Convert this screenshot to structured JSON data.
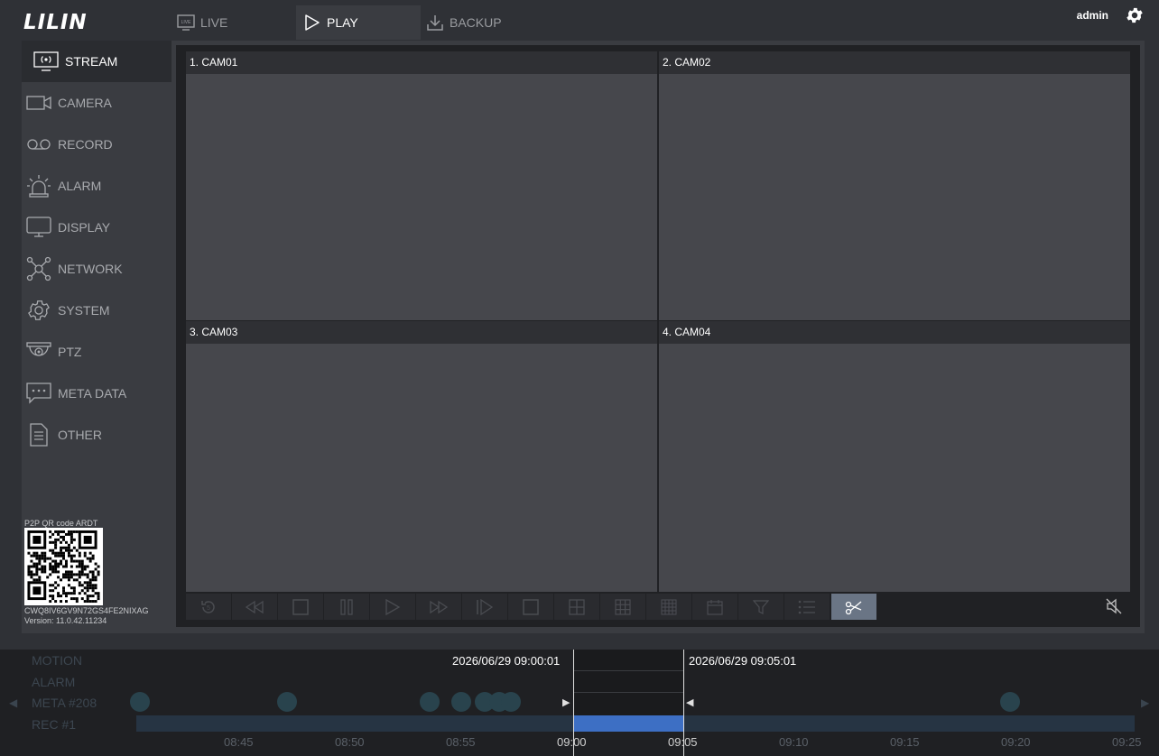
{
  "header": {
    "logo": "LILIN",
    "tabs": [
      {
        "label": "LIVE"
      },
      {
        "label": "PLAY"
      },
      {
        "label": "BACKUP"
      }
    ],
    "user": "admin"
  },
  "sidebar": {
    "items": [
      {
        "label": "STREAM",
        "icon": "stream-icon"
      },
      {
        "label": "CAMERA",
        "icon": "camera-icon"
      },
      {
        "label": "RECORD",
        "icon": "record-icon"
      },
      {
        "label": "ALARM",
        "icon": "alarm-icon"
      },
      {
        "label": "DISPLAY",
        "icon": "display-icon"
      },
      {
        "label": "NETWORK",
        "icon": "network-icon"
      },
      {
        "label": "SYSTEM",
        "icon": "system-icon"
      },
      {
        "label": "PTZ",
        "icon": "ptz-icon"
      },
      {
        "label": "META DATA",
        "icon": "metadata-icon"
      },
      {
        "label": "OTHER",
        "icon": "other-icon"
      }
    ],
    "qr_label": "P2P QR code ARDT",
    "qr_code": "CWQ8IV6GV9N72GS4FE2NIXAG",
    "version": "Version: 11.0.42.11234"
  },
  "cameras": [
    {
      "title": "1. CAM01"
    },
    {
      "title": "2. CAM02"
    },
    {
      "title": "3. CAM03"
    },
    {
      "title": "4. CAM04"
    }
  ],
  "controls": {
    "buttons": [
      "replay-icon",
      "rewind-icon",
      "stop-icon",
      "pause-icon",
      "play-icon",
      "fast-forward-icon",
      "step-forward-icon",
      "layout-1-icon",
      "layout-4-icon",
      "layout-9-icon",
      "layout-16-icon",
      "calendar-icon",
      "filter-icon",
      "list-icon",
      "cut-icon"
    ],
    "mute_icon": "mute-icon"
  },
  "timeline": {
    "labels": [
      "MOTION",
      "ALARM",
      "META #208",
      "REC #1"
    ],
    "start_time": "2026/06/29 09:00:01",
    "end_time": "2026/06/29 09:05:01",
    "ticks": [
      "08:45",
      "08:50",
      "08:55",
      "09:00",
      "09:05",
      "09:10",
      "09:15",
      "09:20",
      "09:25"
    ]
  },
  "colors": {
    "accent": "#3d6fc4",
    "active_control": "#6a7585"
  }
}
